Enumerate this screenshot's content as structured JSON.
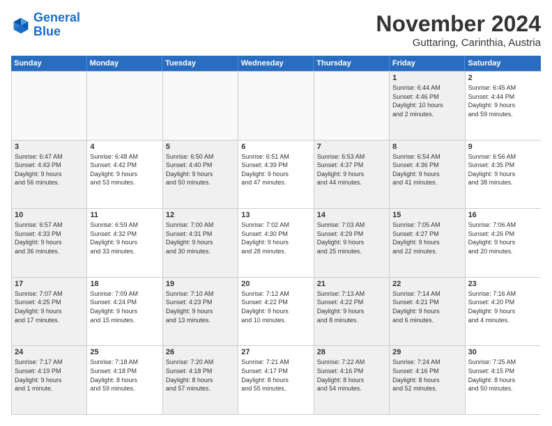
{
  "logo": {
    "line1": "General",
    "line2": "Blue"
  },
  "title": "November 2024",
  "subtitle": "Guttaring, Carinthia, Austria",
  "header_days": [
    "Sunday",
    "Monday",
    "Tuesday",
    "Wednesday",
    "Thursday",
    "Friday",
    "Saturday"
  ],
  "weeks": [
    [
      {
        "day": "",
        "info": "",
        "empty": true
      },
      {
        "day": "",
        "info": "",
        "empty": true
      },
      {
        "day": "",
        "info": "",
        "empty": true
      },
      {
        "day": "",
        "info": "",
        "empty": true
      },
      {
        "day": "",
        "info": "",
        "empty": true
      },
      {
        "day": "1",
        "info": "Sunrise: 6:44 AM\nSunset: 4:46 PM\nDaylight: 10 hours\nand 2 minutes.",
        "shaded": true
      },
      {
        "day": "2",
        "info": "Sunrise: 6:45 AM\nSunset: 4:44 PM\nDaylight: 9 hours\nand 59 minutes.",
        "shaded": false
      }
    ],
    [
      {
        "day": "3",
        "info": "Sunrise: 6:47 AM\nSunset: 4:43 PM\nDaylight: 9 hours\nand 56 minutes.",
        "shaded": true
      },
      {
        "day": "4",
        "info": "Sunrise: 6:48 AM\nSunset: 4:42 PM\nDaylight: 9 hours\nand 53 minutes."
      },
      {
        "day": "5",
        "info": "Sunrise: 6:50 AM\nSunset: 4:40 PM\nDaylight: 9 hours\nand 50 minutes.",
        "shaded": true
      },
      {
        "day": "6",
        "info": "Sunrise: 6:51 AM\nSunset: 4:39 PM\nDaylight: 9 hours\nand 47 minutes."
      },
      {
        "day": "7",
        "info": "Sunrise: 6:53 AM\nSunset: 4:37 PM\nDaylight: 9 hours\nand 44 minutes.",
        "shaded": true
      },
      {
        "day": "8",
        "info": "Sunrise: 6:54 AM\nSunset: 4:36 PM\nDaylight: 9 hours\nand 41 minutes.",
        "shaded": true
      },
      {
        "day": "9",
        "info": "Sunrise: 6:56 AM\nSunset: 4:35 PM\nDaylight: 9 hours\nand 38 minutes."
      }
    ],
    [
      {
        "day": "10",
        "info": "Sunrise: 6:57 AM\nSunset: 4:33 PM\nDaylight: 9 hours\nand 36 minutes.",
        "shaded": true
      },
      {
        "day": "11",
        "info": "Sunrise: 6:59 AM\nSunset: 4:32 PM\nDaylight: 9 hours\nand 33 minutes."
      },
      {
        "day": "12",
        "info": "Sunrise: 7:00 AM\nSunset: 4:31 PM\nDaylight: 9 hours\nand 30 minutes.",
        "shaded": true
      },
      {
        "day": "13",
        "info": "Sunrise: 7:02 AM\nSunset: 4:30 PM\nDaylight: 9 hours\nand 28 minutes."
      },
      {
        "day": "14",
        "info": "Sunrise: 7:03 AM\nSunset: 4:29 PM\nDaylight: 9 hours\nand 25 minutes.",
        "shaded": true
      },
      {
        "day": "15",
        "info": "Sunrise: 7:05 AM\nSunset: 4:27 PM\nDaylight: 9 hours\nand 22 minutes.",
        "shaded": true
      },
      {
        "day": "16",
        "info": "Sunrise: 7:06 AM\nSunset: 4:26 PM\nDaylight: 9 hours\nand 20 minutes."
      }
    ],
    [
      {
        "day": "17",
        "info": "Sunrise: 7:07 AM\nSunset: 4:25 PM\nDaylight: 9 hours\nand 17 minutes.",
        "shaded": true
      },
      {
        "day": "18",
        "info": "Sunrise: 7:09 AM\nSunset: 4:24 PM\nDaylight: 9 hours\nand 15 minutes."
      },
      {
        "day": "19",
        "info": "Sunrise: 7:10 AM\nSunset: 4:23 PM\nDaylight: 9 hours\nand 13 minutes.",
        "shaded": true
      },
      {
        "day": "20",
        "info": "Sunrise: 7:12 AM\nSunset: 4:22 PM\nDaylight: 9 hours\nand 10 minutes."
      },
      {
        "day": "21",
        "info": "Sunrise: 7:13 AM\nSunset: 4:22 PM\nDaylight: 9 hours\nand 8 minutes.",
        "shaded": true
      },
      {
        "day": "22",
        "info": "Sunrise: 7:14 AM\nSunset: 4:21 PM\nDaylight: 9 hours\nand 6 minutes.",
        "shaded": true
      },
      {
        "day": "23",
        "info": "Sunrise: 7:16 AM\nSunset: 4:20 PM\nDaylight: 9 hours\nand 4 minutes."
      }
    ],
    [
      {
        "day": "24",
        "info": "Sunrise: 7:17 AM\nSunset: 4:19 PM\nDaylight: 9 hours\nand 1 minute.",
        "shaded": true
      },
      {
        "day": "25",
        "info": "Sunrise: 7:18 AM\nSunset: 4:18 PM\nDaylight: 8 hours\nand 59 minutes."
      },
      {
        "day": "26",
        "info": "Sunrise: 7:20 AM\nSunset: 4:18 PM\nDaylight: 8 hours\nand 57 minutes.",
        "shaded": true
      },
      {
        "day": "27",
        "info": "Sunrise: 7:21 AM\nSunset: 4:17 PM\nDaylight: 8 hours\nand 55 minutes."
      },
      {
        "day": "28",
        "info": "Sunrise: 7:22 AM\nSunset: 4:16 PM\nDaylight: 8 hours\nand 54 minutes.",
        "shaded": true
      },
      {
        "day": "29",
        "info": "Sunrise: 7:24 AM\nSunset: 4:16 PM\nDaylight: 8 hours\nand 52 minutes.",
        "shaded": true
      },
      {
        "day": "30",
        "info": "Sunrise: 7:25 AM\nSunset: 4:15 PM\nDaylight: 8 hours\nand 50 minutes."
      }
    ]
  ]
}
